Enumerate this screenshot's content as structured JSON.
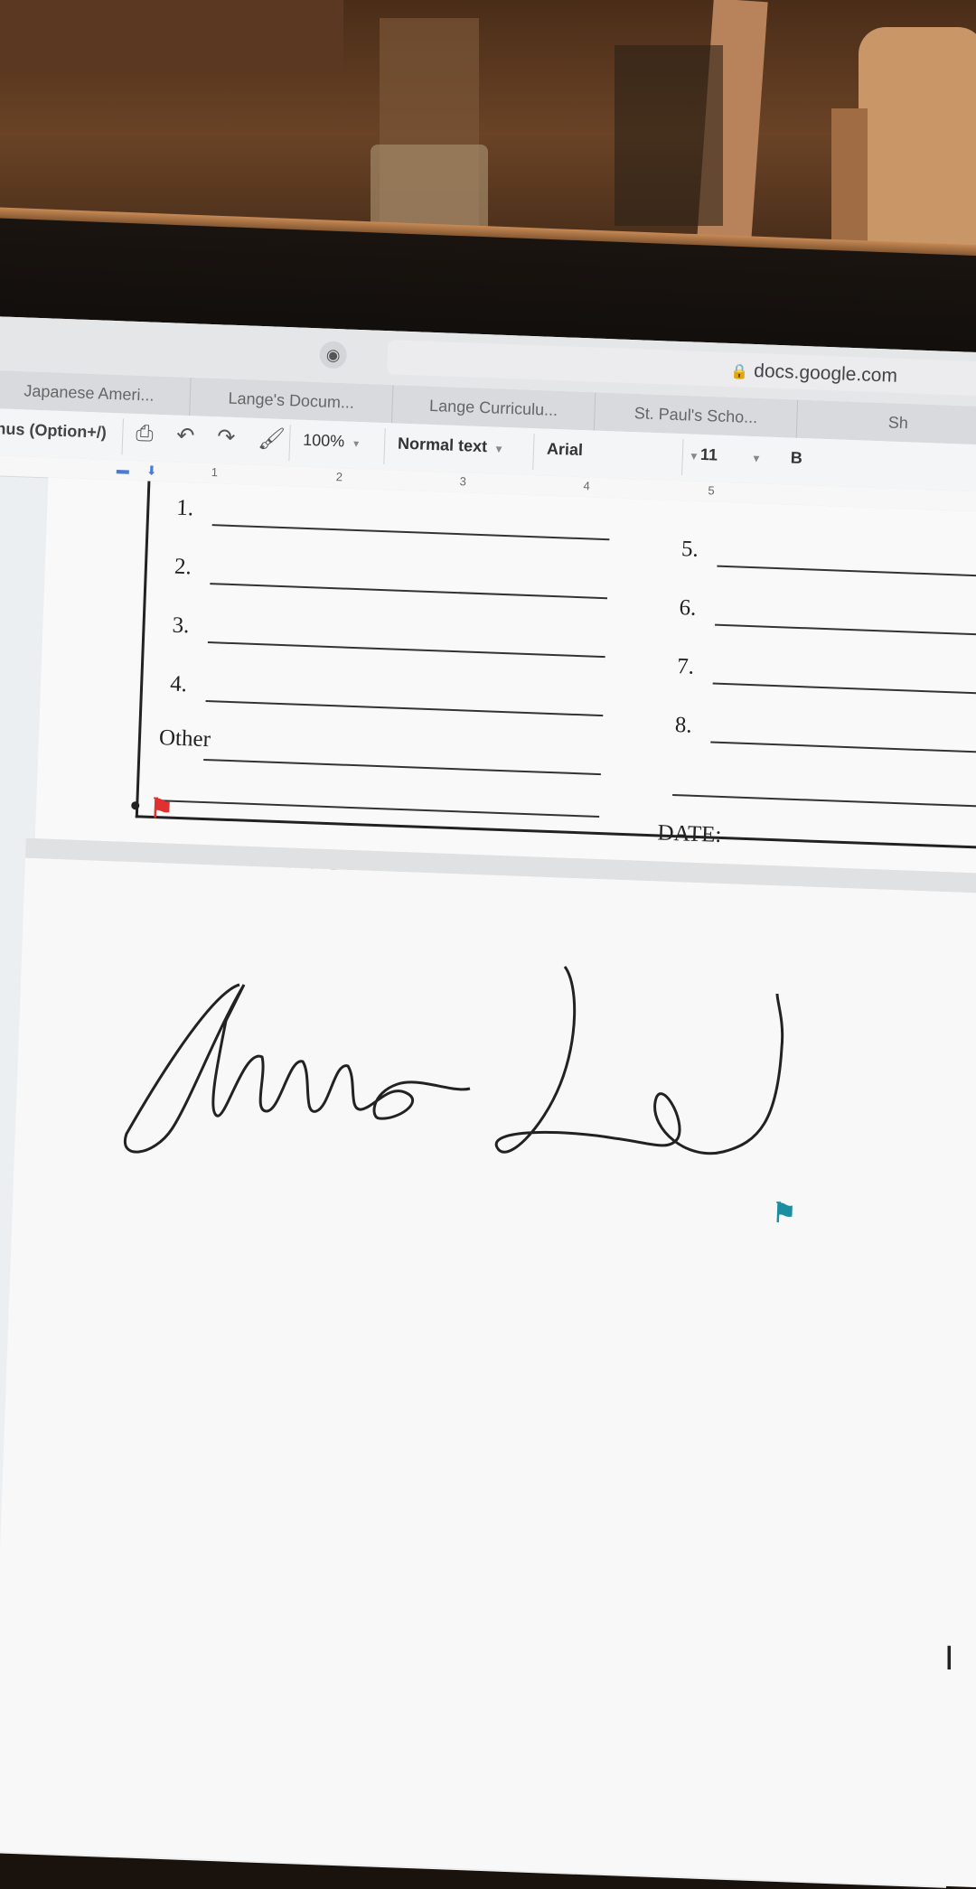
{
  "browser": {
    "url": "docs.google.com",
    "tabs": [
      "Japanese Ameri...",
      "Lange's Docum...",
      "Lange Curriculu...",
      "St. Paul's Scho...",
      "Sh"
    ]
  },
  "toolbar": {
    "menus_label": "enus (Option+/)",
    "zoom": "100%",
    "style": "Normal text",
    "font": "Arial",
    "font_size": "11",
    "bold_partial": "B"
  },
  "ruler": {
    "numbers": [
      "1",
      "2",
      "3",
      "4",
      "5"
    ]
  },
  "form": {
    "left_items": [
      "1.",
      "2.",
      "3.",
      "4."
    ],
    "right_items": [
      "5.",
      "6.",
      "7.",
      "8."
    ],
    "other_label": "Other",
    "date_label": "DATE:"
  },
  "signature": {
    "description_icon": "signature-drawing"
  },
  "colors": {
    "flag_red": "#e03131",
    "flag_teal": "#1c8ea3"
  }
}
